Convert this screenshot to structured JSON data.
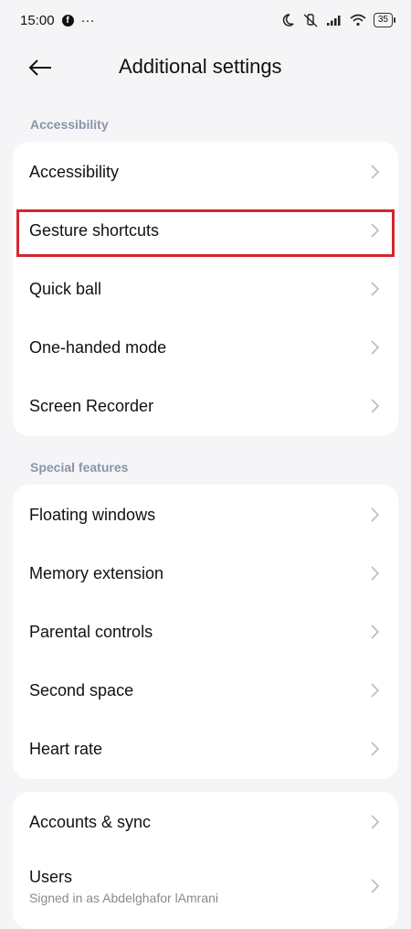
{
  "status": {
    "time": "15:00",
    "more": "···",
    "battery": "35"
  },
  "header": {
    "title": "Additional settings"
  },
  "sections": {
    "accessibility_label": "Accessibility",
    "special_label": "Special features"
  },
  "accessibility_items": [
    {
      "label": "Accessibility"
    },
    {
      "label": "Gesture shortcuts"
    },
    {
      "label": "Quick ball"
    },
    {
      "label": "One-handed mode"
    },
    {
      "label": "Screen Recorder"
    }
  ],
  "special_items": [
    {
      "label": "Floating windows"
    },
    {
      "label": "Memory extension"
    },
    {
      "label": "Parental controls"
    },
    {
      "label": "Second space"
    },
    {
      "label": "Heart rate"
    }
  ],
  "account_items": [
    {
      "label": "Accounts & sync"
    },
    {
      "label": "Users",
      "subtitle": "Signed in as Abdelghafor lAmrani"
    }
  ],
  "colors": {
    "highlight": "#d6252f",
    "background": "#f5f5f7",
    "section_label": "#8a94a6"
  }
}
